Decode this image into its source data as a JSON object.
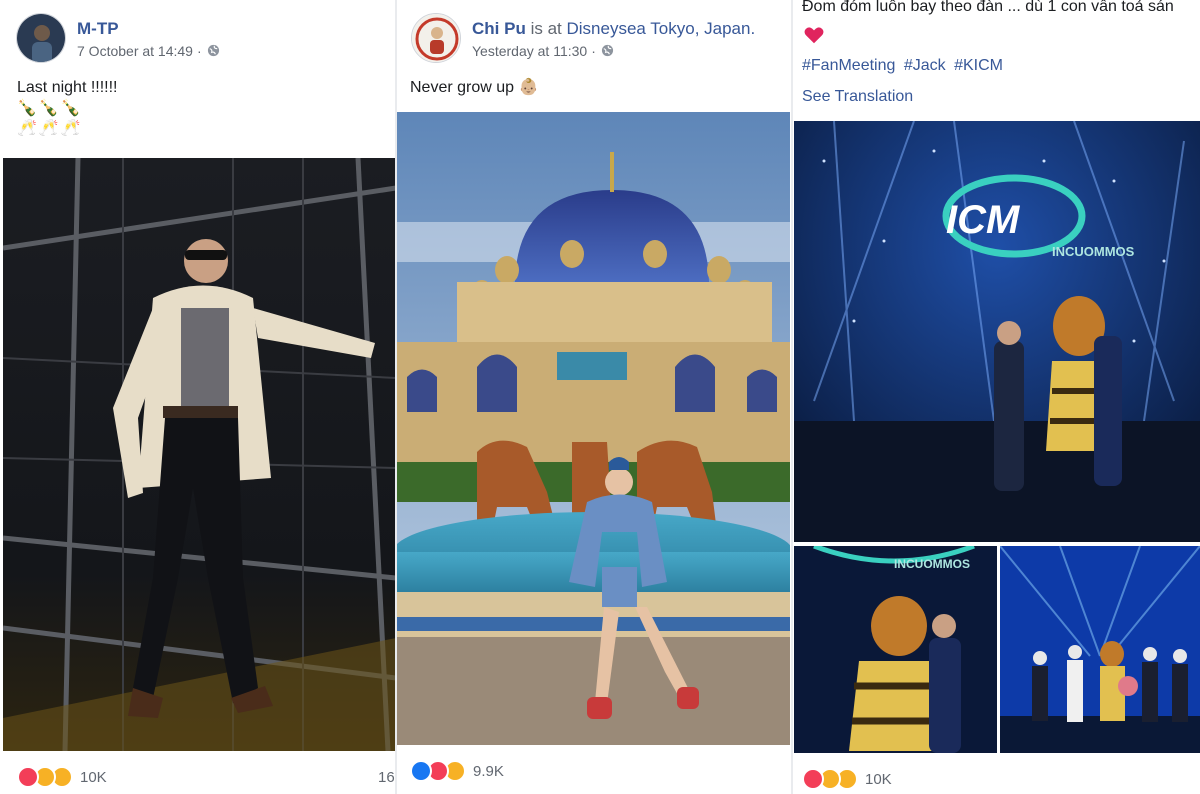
{
  "posts": [
    {
      "author": "M-TP",
      "time": "7 October at 14:49",
      "time_sep": "·",
      "caption": "Last night !!!!!!",
      "emoji_line_1": "🍾🍾🍾",
      "emoji_line_2": "🥂🥂🥂",
      "reactions": [
        "love",
        "haha",
        "wow"
      ],
      "reaction_count": "10K",
      "right_count": "16"
    },
    {
      "author": "Chi Pu",
      "checkin_text": "is at",
      "place": "Disneysea Tokyo, Japan.",
      "time": "Yesterday at 11:30",
      "time_sep": "·",
      "caption": "Never grow up",
      "caption_emoji": "👶🏼",
      "reactions": [
        "like",
        "love",
        "haha"
      ],
      "reaction_count": "9.9K"
    },
    {
      "text": "Đom đóm luôn bay theo đàn ... dù 1 con vẫn toả sán",
      "hashtags": [
        "#FanMeeting",
        "#Jack",
        "#KICM"
      ],
      "see_translation": "See Translation",
      "photo_logo": "ICM",
      "photo_logo_sub": "INCUOMMOS",
      "photo_logo_sub_2": "INCUOMMOS",
      "reactions": [
        "love",
        "haha",
        "sad"
      ],
      "reaction_count": "10K"
    }
  ],
  "colors": {
    "link": "#385898",
    "secondary_text": "#616770",
    "love": "#f33e58",
    "like": "#1877f2",
    "haha": "#f7b125"
  }
}
